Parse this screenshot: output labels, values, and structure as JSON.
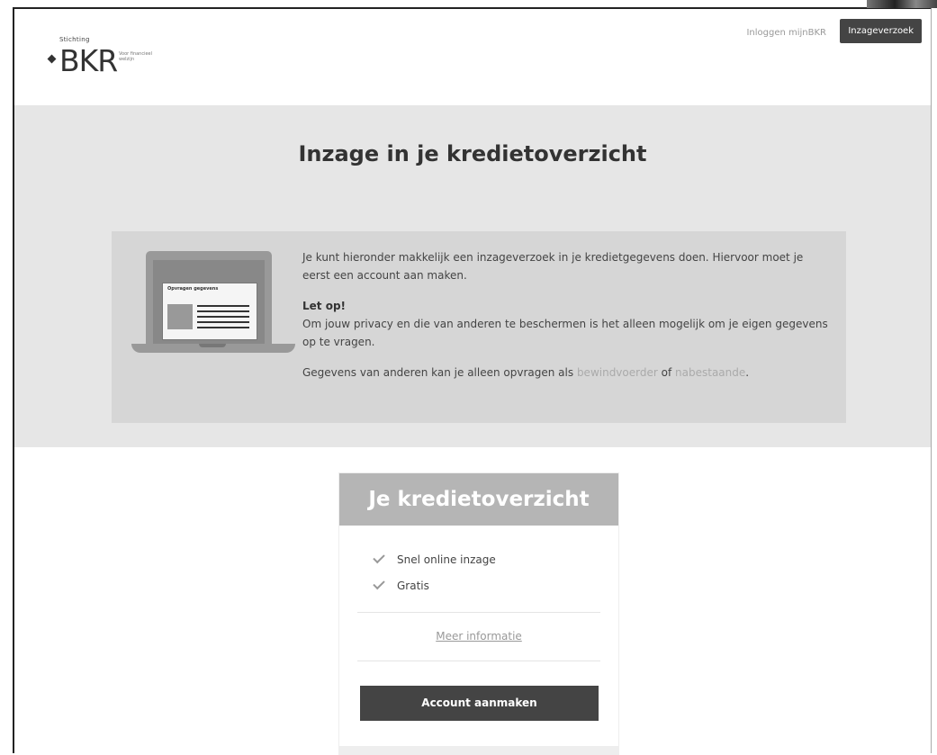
{
  "header": {
    "logo_small": "Stichting",
    "logo_word": "BKR",
    "logo_tagline": "Voor financieel welzijn",
    "login_link": "Inloggen mijnBKR",
    "request_button": "Inzageverzoek"
  },
  "hero": {
    "title": "Inzage in je kredietoverzicht",
    "illustration_card_title": "Opvragen gegevens",
    "intro": "Je kunt hieronder makkelijk een inzageverzoek in je kredietgegevens doen. Hiervoor moet je eerst een account aan maken.",
    "letop_heading": "Let op!",
    "letop_text": "Om jouw privacy en die van anderen te beschermen is het alleen mogelijk om je eigen gegevens op te vragen.",
    "others_prefix": "Gegevens van anderen kan je alleen opvragen als",
    "others_link1": "bewindvoerder",
    "others_mid": "of",
    "others_link2": "nabestaande",
    "others_suffix": "."
  },
  "card": {
    "title": "Je kredietoverzicht",
    "features": [
      "Snel online inzage",
      "Gratis"
    ],
    "more_info": "Meer informatie",
    "cta": "Account aanmaken"
  }
}
